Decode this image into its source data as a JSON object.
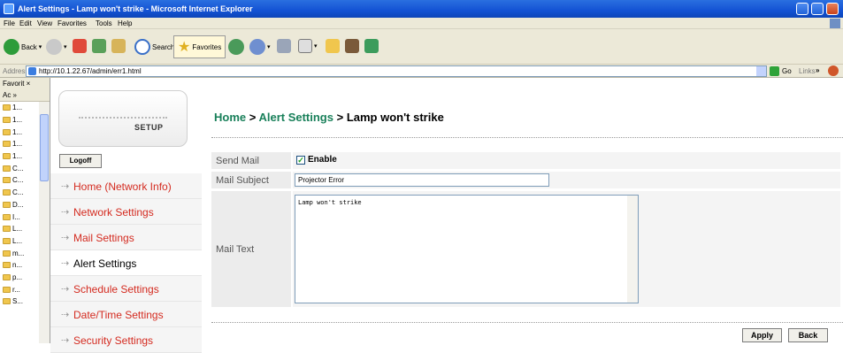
{
  "window": {
    "title": "Alert Settings - Lamp won't strike - Microsoft Internet Explorer"
  },
  "menu": [
    "File",
    "Edit",
    "View",
    "Favorites",
    "Tools",
    "Help"
  ],
  "toolbar": {
    "back_label": "Back",
    "search_label": "Search",
    "favorites_label": "Favorites"
  },
  "address": {
    "label": "Address",
    "url": "http://10.1.22.67/admin/err1.html",
    "go_label": "Go",
    "links_label": "Links"
  },
  "favorites": {
    "header": "Favorit ×",
    "sub": "Ac »",
    "items": [
      "1...",
      "1...",
      "1...",
      "1...",
      "1...",
      "C...",
      "C...",
      "C...",
      "D...",
      "I...",
      "L...",
      "L...",
      "m...",
      "n...",
      "p...",
      "r...",
      "S..."
    ]
  },
  "sidebar": {
    "logo_text": "Setup",
    "logoff_label": "Logoff",
    "nav": [
      {
        "label": "Home (Network Info)"
      },
      {
        "label": "Network Settings"
      },
      {
        "label": "Mail Settings"
      },
      {
        "label": "Alert Settings"
      },
      {
        "label": "Schedule Settings"
      },
      {
        "label": "Date/Time Settings"
      },
      {
        "label": "Security Settings"
      }
    ]
  },
  "breadcrumb": {
    "home": "Home",
    "sep": " > ",
    "section": "Alert Settings",
    "page": "Lamp won't strike"
  },
  "form": {
    "send_mail_label": "Send Mail",
    "enable_label": "Enable",
    "enable_checked": true,
    "subject_label": "Mail Subject",
    "subject_value": "Projector Error",
    "text_label": "Mail Text",
    "text_value": "Lamp won't strike"
  },
  "buttons": {
    "apply": "Apply",
    "back": "Back"
  }
}
